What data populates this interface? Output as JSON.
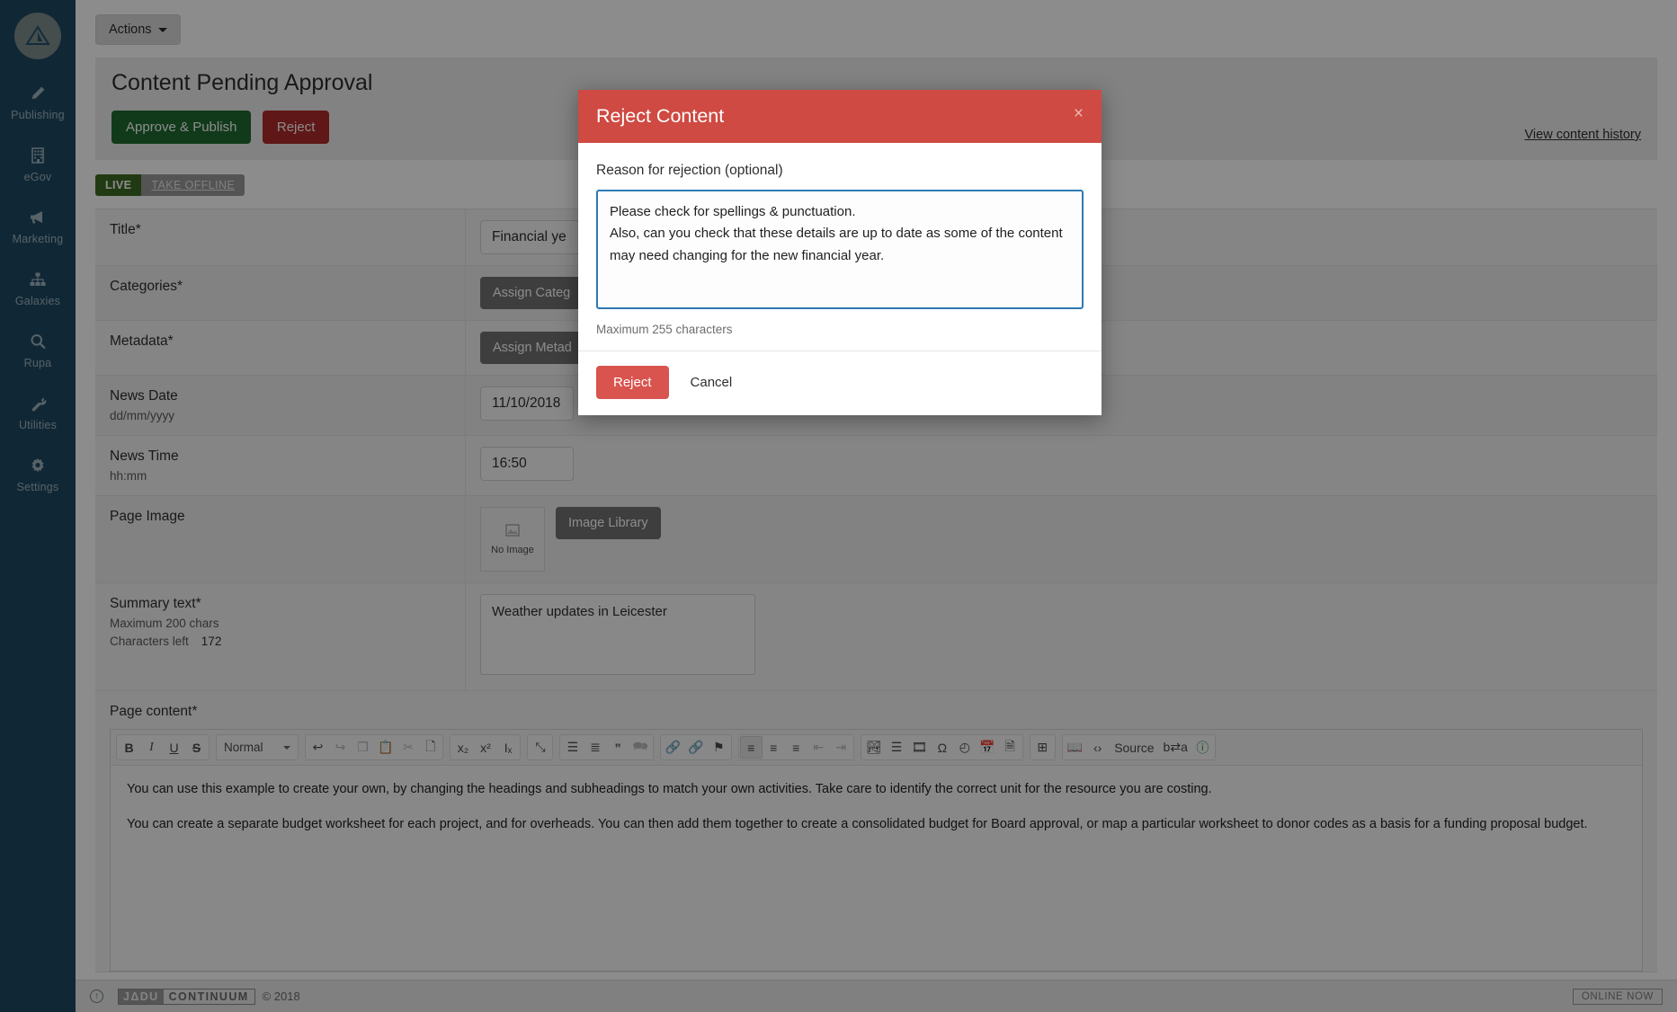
{
  "sidebar": {
    "logo_name": "jadu-triangle-logo",
    "items": [
      {
        "label": "Publishing",
        "icon": "pencil-icon"
      },
      {
        "label": "eGov",
        "icon": "building-icon"
      },
      {
        "label": "Marketing",
        "icon": "megaphone-icon"
      },
      {
        "label": "Galaxies",
        "icon": "sitemap-icon"
      },
      {
        "label": "Rupa",
        "icon": "search-icon"
      },
      {
        "label": "Utilities",
        "icon": "wrench-icon"
      },
      {
        "label": "Settings",
        "icon": "gear-icon"
      }
    ]
  },
  "toolbar": {
    "actions_label": "Actions"
  },
  "header": {
    "title": "Content Pending Approval",
    "approve_label": "Approve & Publish",
    "reject_label": "Reject",
    "history_link": "View content history"
  },
  "status": {
    "live_label": "LIVE",
    "take_offline_label": "TAKE OFFLINE"
  },
  "form": {
    "rows": [
      {
        "label": "Title*",
        "hint": "",
        "value": "Financial ye",
        "type": "text"
      },
      {
        "label": "Categories*",
        "hint": "",
        "value": "Assign Categ",
        "type": "button"
      },
      {
        "label": "Metadata*",
        "hint": "",
        "value": "Assign Metad",
        "type": "button"
      },
      {
        "label": "News Date",
        "hint": "dd/mm/yyyy",
        "value": "11/10/2018",
        "type": "text-small"
      },
      {
        "label": "News Time",
        "hint": "hh:mm",
        "value": "16:50",
        "type": "text-small"
      }
    ],
    "page_image": {
      "label": "Page Image",
      "placeholder": "No Image",
      "button_label": "Image Library"
    },
    "summary": {
      "label": "Summary text*",
      "hint_max": "Maximum 200 chars",
      "hint_left_label": "Characters left",
      "hint_left_value": "172",
      "value": "Weather updates in Leicester"
    }
  },
  "content": {
    "label": "Page content*",
    "editor": {
      "style_select": "Normal",
      "source_label": "Source",
      "groups": [
        {
          "name": "text-format",
          "buttons": [
            {
              "name": "bold-icon",
              "glyph": "B",
              "state": "on"
            },
            {
              "name": "italic-icon",
              "glyph": "I",
              "state": "on"
            },
            {
              "name": "underline-icon",
              "glyph": "U",
              "state": "on"
            },
            {
              "name": "strikethrough-icon",
              "glyph": "S",
              "state": "on"
            }
          ]
        },
        {
          "name": "clipboard",
          "buttons": [
            {
              "name": "undo-icon",
              "glyph": "↩",
              "state": "on"
            },
            {
              "name": "redo-icon",
              "glyph": "↪",
              "state": "off"
            },
            {
              "name": "copy-icon",
              "glyph": "❐",
              "state": "off"
            },
            {
              "name": "paste-icon",
              "glyph": "📋",
              "state": "on"
            },
            {
              "name": "cut-icon",
              "glyph": "✂",
              "state": "off"
            },
            {
              "name": "paste-from-word-icon",
              "glyph": "🗋",
              "state": "on"
            }
          ]
        },
        {
          "name": "script",
          "buttons": [
            {
              "name": "subscript-icon",
              "glyph": "x₂",
              "state": "on"
            },
            {
              "name": "superscript-icon",
              "glyph": "x²",
              "state": "on"
            },
            {
              "name": "remove-format-icon",
              "glyph": "Iₓ",
              "state": "on"
            }
          ]
        },
        {
          "name": "maximize",
          "buttons": [
            {
              "name": "maximize-icon",
              "glyph": "⤡",
              "state": "on"
            }
          ]
        },
        {
          "name": "lists",
          "buttons": [
            {
              "name": "numbered-list-icon",
              "glyph": "☰",
              "state": "on"
            },
            {
              "name": "bulleted-list-icon",
              "glyph": "≣",
              "state": "on"
            },
            {
              "name": "blockquote-icon",
              "glyph": "”",
              "state": "on"
            },
            {
              "name": "comment-icon",
              "glyph": "🗪",
              "state": "off"
            }
          ]
        },
        {
          "name": "links",
          "buttons": [
            {
              "name": "link-icon",
              "glyph": "🔗",
              "state": "on"
            },
            {
              "name": "unlink-icon",
              "glyph": "🔗",
              "state": "off"
            },
            {
              "name": "anchor-icon",
              "glyph": "⚑",
              "state": "on"
            }
          ]
        },
        {
          "name": "align",
          "buttons": [
            {
              "name": "align-left-icon",
              "glyph": "≡",
              "state": "active"
            },
            {
              "name": "align-center-icon",
              "glyph": "≡",
              "state": "on"
            },
            {
              "name": "align-right-icon",
              "glyph": "≡",
              "state": "on"
            },
            {
              "name": "outdent-icon",
              "glyph": "⇤",
              "state": "off"
            },
            {
              "name": "indent-icon",
              "glyph": "⇥",
              "state": "off"
            }
          ]
        },
        {
          "name": "insert",
          "buttons": [
            {
              "name": "image-icon",
              "glyph": "🏞",
              "state": "on"
            },
            {
              "name": "horizontal-rule-icon",
              "glyph": "☰",
              "state": "on"
            },
            {
              "name": "media-icon",
              "glyph": "🎞",
              "state": "on"
            },
            {
              "name": "special-character-icon",
              "glyph": "Ω",
              "state": "on"
            },
            {
              "name": "clock-icon",
              "glyph": "◴",
              "state": "on"
            },
            {
              "name": "calendar-icon",
              "glyph": "📅",
              "state": "on"
            },
            {
              "name": "document-insert-icon",
              "glyph": "🗎",
              "state": "on"
            }
          ]
        },
        {
          "name": "table",
          "buttons": [
            {
              "name": "table-icon",
              "glyph": "⊞",
              "state": "on"
            }
          ]
        },
        {
          "name": "tools",
          "buttons": [
            {
              "name": "read-more-icon",
              "glyph": "📖",
              "state": "on"
            },
            {
              "name": "source-icon",
              "glyph": "‹›",
              "state": "on"
            },
            {
              "name": "source-label",
              "glyph": "Source",
              "state": "label"
            },
            {
              "name": "find-replace-icon",
              "glyph": "b⇄a",
              "state": "on"
            },
            {
              "name": "about-icon",
              "glyph": "ⓘ",
              "state": "on"
            }
          ]
        }
      ]
    },
    "paragraphs": [
      "You can use this example to create your own, by changing the headings and subheadings to match your own activities. Take care to identify the correct unit for the resource you are costing.",
      "You can create a separate budget worksheet for each project, and for overheads.  You can then add them together to create a consolidated budget for Board approval, or map a particular worksheet to donor codes as a basis for a funding proposal budget."
    ]
  },
  "modal": {
    "title": "Reject Content",
    "close_glyph": "×",
    "reason_label": "Reason for rejection (optional)",
    "reason_value": "Please check for spellings & punctuation.\nAlso, can you check that these details are up to date as some of the content may need changing for the new financial year.",
    "max_note": "Maximum 255 characters",
    "reject_label": "Reject",
    "cancel_label": "Cancel",
    "header_color": "#cf4a42",
    "reject_button_color": "#d9534f",
    "textarea_focus_color": "#2d7ab5"
  },
  "footer": {
    "brand_left": "JΔDU",
    "brand_right": "CONTINUUM",
    "copyright": "© 2018",
    "online_now": "ONLINE NOW",
    "scroll_top_glyph": "↑"
  }
}
